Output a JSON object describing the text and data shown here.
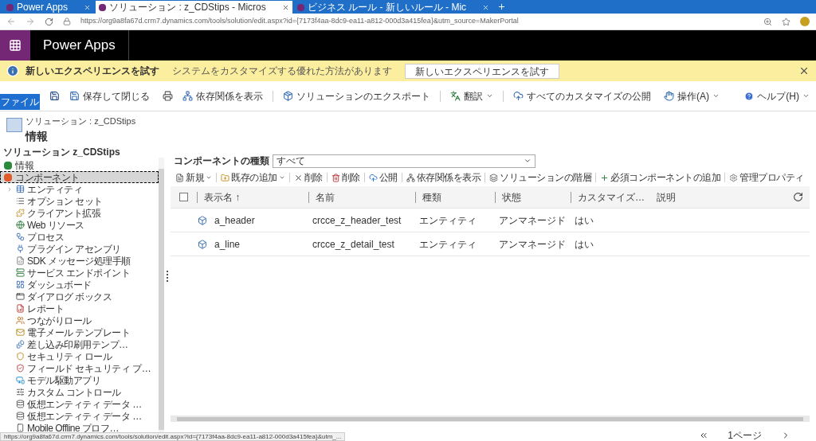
{
  "browser": {
    "tabs": [
      {
        "title": "Power Apps",
        "selected": false
      },
      {
        "title": "ソリューション : z_CDStips - Micros",
        "selected": true
      },
      {
        "title": "ビジネス ルール - 新しいルール - Mic",
        "selected": false
      }
    ],
    "url": "https://org9a8fa67d.crm7.dynamics.com/tools/solution/edit.aspx?id={7173f4aa-8dc9-ea11-a812-000d3a415fea}&utm_source=MakerPortal"
  },
  "app_title": "Power Apps",
  "banner": {
    "title": "新しいエクスペリエンスを試す",
    "message": "システムをカスタマイズする優れた方法があります",
    "button": "新しいエクスペリエンスを試す"
  },
  "ribbon": {
    "file_tab": "ファイル",
    "items": [
      {
        "label": "保存して閉じる",
        "dropdown": false
      },
      {
        "label": "依存関係を表示",
        "dropdown": false
      },
      {
        "label": "ソリューションのエクスポート",
        "dropdown": false
      },
      {
        "label": "翻訳",
        "dropdown": true
      },
      {
        "label": "すべてのカスタマイズの公開",
        "dropdown": false
      },
      {
        "label": "操作(A)",
        "dropdown": true
      }
    ],
    "help": "ヘルプ(H)"
  },
  "header": {
    "breadcrumb": "ソリューション : z_CDStips",
    "title": "情報"
  },
  "sidebar": {
    "solution_title": "ソリューション z_CDStips",
    "items": [
      {
        "label": "情報",
        "selected": false
      },
      {
        "label": "コンポーネント",
        "selected": true,
        "children": [
          {
            "label": "エンティティ",
            "expanded": false
          },
          {
            "label": "オプション セット"
          },
          {
            "label": "クライアント拡張"
          },
          {
            "label": "Web リソース"
          },
          {
            "label": "プロセス"
          },
          {
            "label": "プラグイン アセンブリ"
          },
          {
            "label": "SDK メッセージ処理手順"
          },
          {
            "label": "サービス エンドポイント"
          },
          {
            "label": "ダッシュボード"
          },
          {
            "label": "ダイアログ ボックス"
          },
          {
            "label": "レポート"
          },
          {
            "label": "つながりロール"
          },
          {
            "label": "電子メール テンプレート"
          },
          {
            "label": "差し込み印刷用テンプ…"
          },
          {
            "label": "セキュリティ ロール"
          },
          {
            "label": "フィールド セキュリティ プ…"
          },
          {
            "label": "モデル駆動アプリ"
          },
          {
            "label": "カスタム コントロール"
          },
          {
            "label": "仮想エンティティ データ …"
          },
          {
            "label": "仮想エンティティ データ …"
          },
          {
            "label": "Mobile Offline プロフ…"
          }
        ]
      }
    ]
  },
  "component_type": {
    "label": "コンポーネントの種類",
    "value": "すべて"
  },
  "toolbar": [
    {
      "label": "新規",
      "dropdown": true
    },
    {
      "label": "既存の追加",
      "dropdown": true
    },
    {
      "label": "削除",
      "dropdown": false
    },
    {
      "label": "削除",
      "dropdown": false
    },
    {
      "label": "公開",
      "dropdown": false
    },
    {
      "label": "依存関係を表示",
      "dropdown": false
    },
    {
      "label": "ソリューションの階層",
      "dropdown": false
    },
    {
      "label": "必須コンポーネントの追加",
      "dropdown": false
    },
    {
      "label": "管理プロパティ",
      "dropdown": false
    }
  ],
  "grid": {
    "all_selected": false,
    "columns": [
      "表示名 ↑",
      "名前",
      "種類",
      "状態",
      "カスタマイズ…",
      "説明"
    ],
    "rows": [
      {
        "cells": [
          "a_header",
          "crcce_z_header_test",
          "エンティティ",
          "アンマネージド",
          "はい"
        ]
      },
      {
        "cells": [
          "a_line",
          "crcce_z_detail_test",
          "エンティティ",
          "アンマネージド",
          "はい"
        ]
      }
    ]
  },
  "status_url": "https://org9a8fa67d.crm7.dynamics.com/tools/solution/edit.aspx?id={7173f4aa-8dc9-ea11-a812-000d3a415fea}&utm_...",
  "pagination": "1ページ"
}
